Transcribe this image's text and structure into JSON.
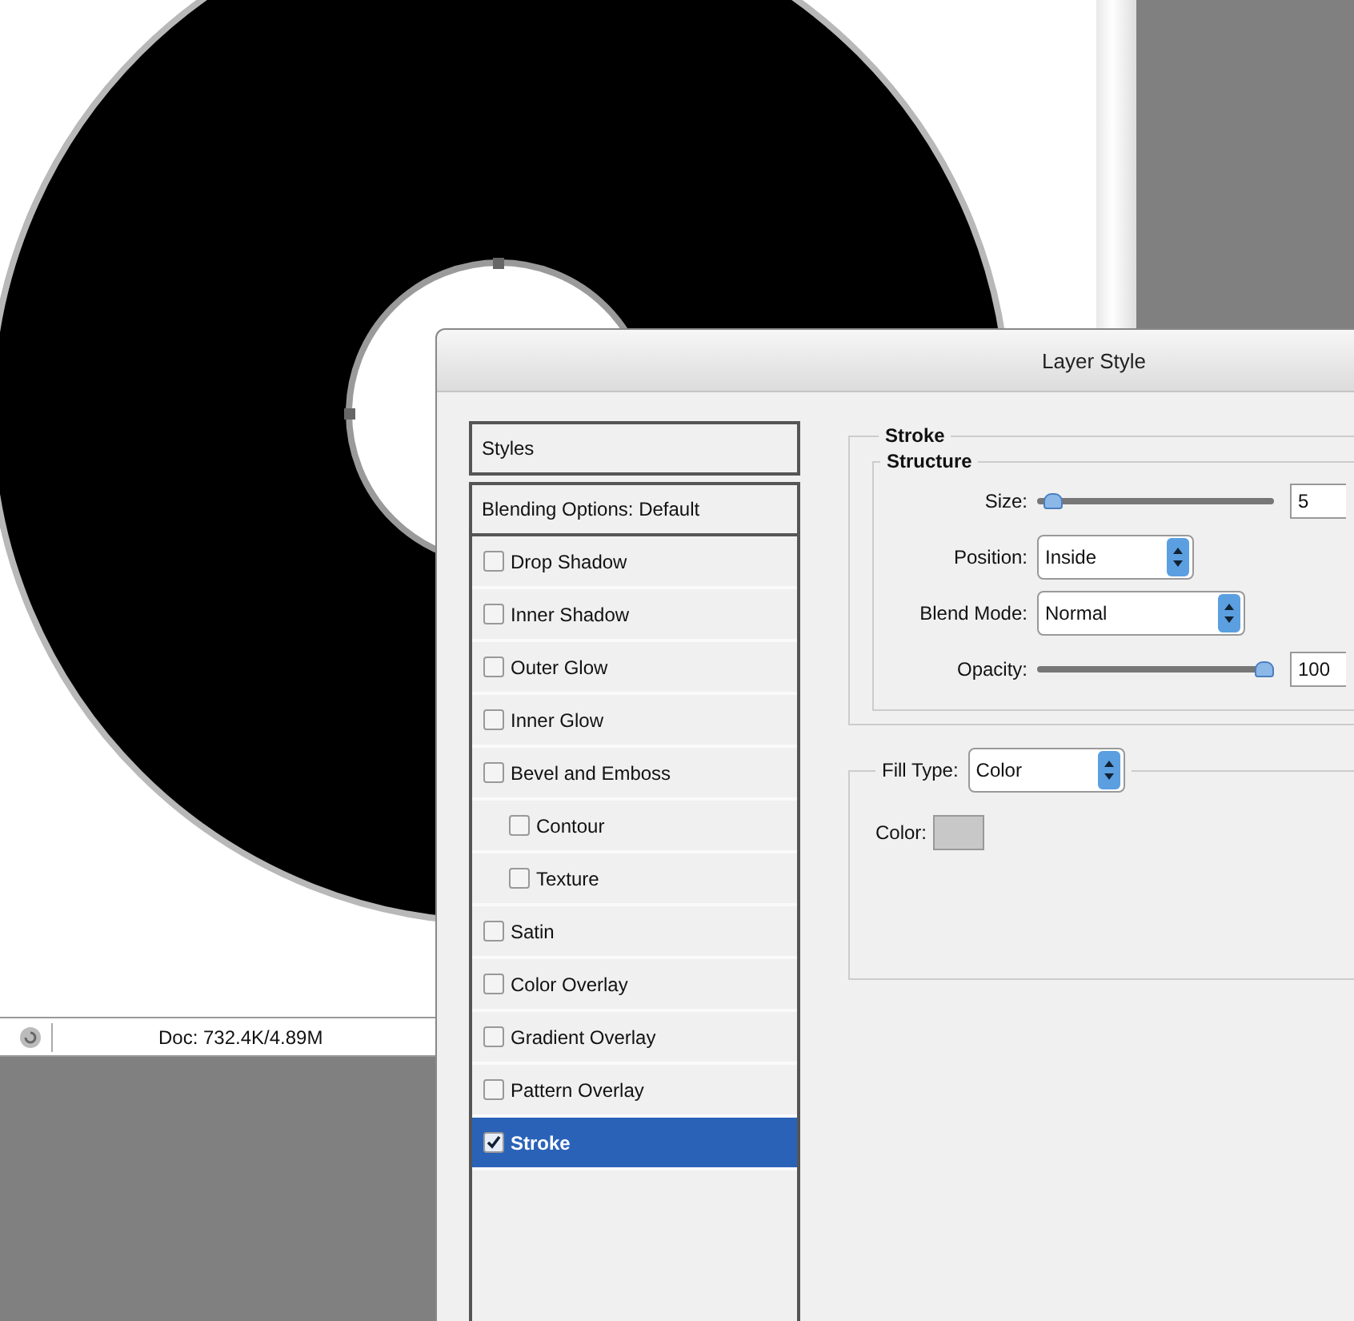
{
  "status_bar": {
    "doc": "Doc: 732.4K/4.89M"
  },
  "dialog": {
    "title": "Layer Style",
    "styles_header": "Styles",
    "blending": "Blending Options: Default",
    "effects": [
      {
        "label": "Drop Shadow",
        "checked": false,
        "selected": false
      },
      {
        "label": "Inner Shadow",
        "checked": false,
        "selected": false
      },
      {
        "label": "Outer Glow",
        "checked": false,
        "selected": false
      },
      {
        "label": "Inner Glow",
        "checked": false,
        "selected": false
      },
      {
        "label": "Bevel and Emboss",
        "checked": false,
        "selected": false,
        "children": [
          {
            "label": "Contour",
            "checked": false,
            "selected": false
          },
          {
            "label": "Texture",
            "checked": false,
            "selected": false
          }
        ]
      },
      {
        "label": "Satin",
        "checked": false,
        "selected": false
      },
      {
        "label": "Color Overlay",
        "checked": false,
        "selected": false
      },
      {
        "label": "Gradient Overlay",
        "checked": false,
        "selected": false
      },
      {
        "label": "Pattern Overlay",
        "checked": false,
        "selected": false
      },
      {
        "label": "Stroke",
        "checked": true,
        "selected": true
      }
    ],
    "stroke": {
      "title": "Stroke",
      "structure": {
        "title": "Structure",
        "size": {
          "label": "Size:",
          "level": 0.03,
          "value": "5"
        },
        "position": {
          "label": "Position:",
          "value": "Inside"
        },
        "blend_mode": {
          "label": "Blend Mode:",
          "value": "Normal"
        },
        "opacity": {
          "label": "Opacity:",
          "level": 1.0,
          "value": "100"
        }
      },
      "fill_type": {
        "label": "Fill Type:",
        "value": "Color"
      },
      "color": {
        "label": "Color:",
        "color": "#c8c8c8"
      }
    }
  }
}
